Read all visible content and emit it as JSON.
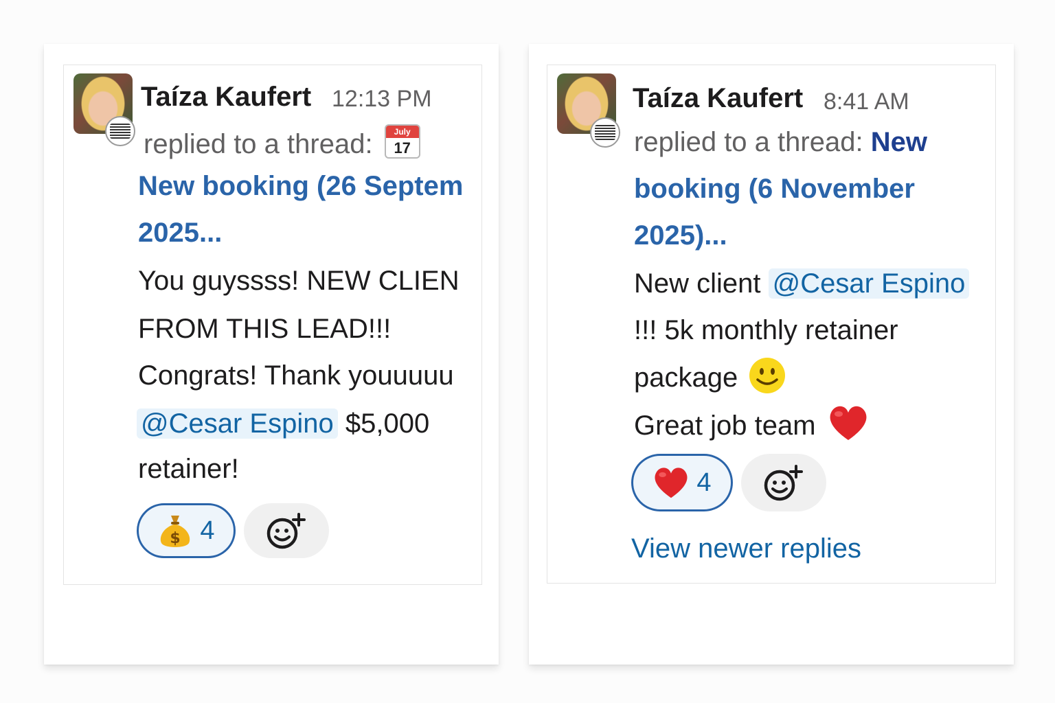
{
  "messages": [
    {
      "author": "Taíza Kaufert",
      "time": "12:13 PM",
      "meta_text": "replied to a thread:",
      "calendar_month": "July",
      "calendar_day": "17",
      "thread_title_line1": "New booking (26 Septem",
      "thread_title_line2": "2025...",
      "body_line1": "You guyssss! NEW CLIEN",
      "body_line2": "FROM THIS LEAD!!!",
      "body_line3": "Congrats! Thank youuuuu",
      "mention": "@Cesar Espino",
      "body_line4_rest": "$5,000",
      "body_line5": "retainer!",
      "reaction": {
        "emoji_name": "money-bag-icon",
        "count": "4"
      },
      "accent": "#2a64a9"
    },
    {
      "author": "Taíza Kaufert",
      "time": "8:41 AM",
      "meta_text": "replied to a thread:",
      "thread_title_word1": "New",
      "thread_title_line2": "booking (6 November",
      "thread_title_line3": "2025)...",
      "body_line1_start": "New client",
      "mention": "@Cesar Espino",
      "body_line2": "!!! 5k monthly retainer",
      "body_line3": "package",
      "body_line4": "Great job team",
      "reaction": {
        "emoji_name": "heart-icon",
        "count": "4"
      },
      "view_newer": "View newer replies",
      "accent": "#2a64a9"
    }
  ]
}
